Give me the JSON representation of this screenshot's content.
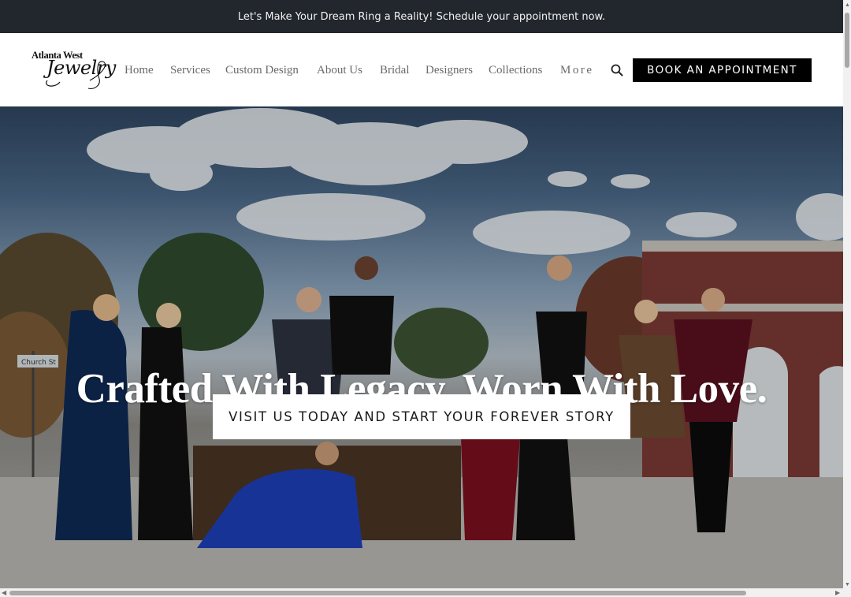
{
  "announcement": {
    "text": "Let's Make Your Dream Ring a Reality! Schedule your appointment now."
  },
  "logo": {
    "line1": "Atlanta West",
    "line2": "Jewelry"
  },
  "nav": {
    "items": [
      {
        "label": "Home"
      },
      {
        "label": "Services"
      },
      {
        "label": "Custom Design"
      },
      {
        "label": "About Us"
      },
      {
        "label": "Bridal"
      },
      {
        "label": "Designers"
      },
      {
        "label": "Collections"
      },
      {
        "label": "More"
      }
    ],
    "search_icon": "search-icon",
    "book_label": "BOOK AN APPOINTMENT"
  },
  "hero": {
    "headline": "Crafted With Legacy. Worn With Love.",
    "cta_label": "VISIT US TODAY AND START YOUR FOREVER STORY",
    "street_sign": "Church St"
  },
  "colors": {
    "announcement_bg": "#22272d",
    "button_bg": "#000000",
    "nav_text": "#6a6a6a",
    "cta_bg": "#ffffff"
  }
}
